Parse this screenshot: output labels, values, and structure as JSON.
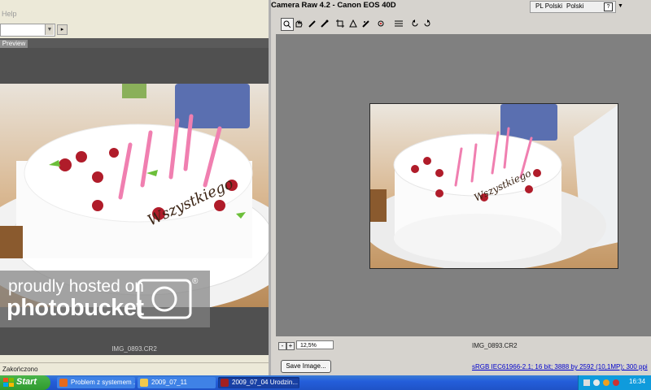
{
  "left_window": {
    "menu_help": "Help",
    "tab_preview": "Preview",
    "caption": "IMG_0893.CR2",
    "status": "Zakończono"
  },
  "watermark": {
    "line1": "proudly hosted on",
    "line2": "photobucket",
    "registered": "®"
  },
  "right_window": {
    "title": "Camera Raw 4.2  -  Canon EOS 40D",
    "lang_code": "PL Polski",
    "lang_name": "Polski",
    "help": "?",
    "toolbar": [
      "zoom-tool",
      "hand-tool",
      "white-balance-tool",
      "color-sampler-tool",
      "crop-tool",
      "straighten-tool",
      "retouch-tool",
      "red-eye-tool",
      "preferences",
      "rotate-ccw",
      "rotate-cw"
    ],
    "zoom_value": "12,5%",
    "filename": "IMG_0893.CR2",
    "save_button": "Save Image...",
    "info_link": "sRGB IEC61966-2.1; 16 bit; 3888 by 2592 (10,1MP); 300 ppi"
  },
  "taskbar": {
    "start": "Start",
    "items": [
      {
        "label": "Problem z systemem ...",
        "icon": "firefox-icon",
        "active": false
      },
      {
        "label": "2009_07_11",
        "icon": "folder-icon",
        "active": false
      },
      {
        "label": "2009_07_04 Urodzin...",
        "icon": "bridge-icon",
        "active": true
      }
    ],
    "clock": "16:34"
  },
  "colors": {
    "taskbar": "#245edb",
    "start": "#2f9a2f",
    "tray": "#0f9bdc",
    "preview_bg": "#808080",
    "dark_panel": "#505050"
  }
}
